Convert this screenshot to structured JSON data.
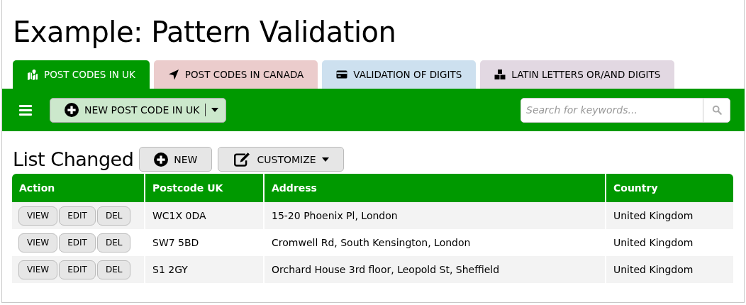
{
  "page": {
    "title": "Example: Pattern Validation"
  },
  "tabs": [
    {
      "label": "POST CODES IN UK",
      "selected": true,
      "color": "#009900"
    },
    {
      "label": "POST CODES IN CANADA",
      "selected": false,
      "color": "#ebcccc"
    },
    {
      "label": "VALIDATION OF DIGITS",
      "selected": false,
      "color": "#cde0ef"
    },
    {
      "label": "LATIN LETTERS OR/AND DIGITS",
      "selected": false,
      "color": "#e2d8e2"
    }
  ],
  "toolbar": {
    "new_button": "NEW POST CODE IN UK",
    "search": {
      "placeholder": "Search for keywords..."
    }
  },
  "list": {
    "heading": "List Changed",
    "buttons": [
      "NEW",
      "CUSTOMIZE"
    ],
    "columns": [
      "Action",
      "Postcode UK",
      "Address",
      "Country"
    ],
    "rows": [
      {
        "actions": [
          "VIEW",
          "EDIT",
          "DEL"
        ],
        "postcode": "WC1X 0DA",
        "address": "15-20 Phoenix Pl, London",
        "country": "United Kingdom"
      },
      {
        "actions": [
          "VIEW",
          "EDIT",
          "DEL"
        ],
        "postcode": "SW7 5BD",
        "address": "Cromwell Rd, South Kensington, London",
        "country": "United Kingdom"
      },
      {
        "actions": [
          "VIEW",
          "EDIT",
          "DEL"
        ],
        "postcode": "S1 2GY",
        "address": "Orchard House 3rd floor, Leopold St, Sheffield",
        "country": "United Kingdom"
      }
    ]
  }
}
